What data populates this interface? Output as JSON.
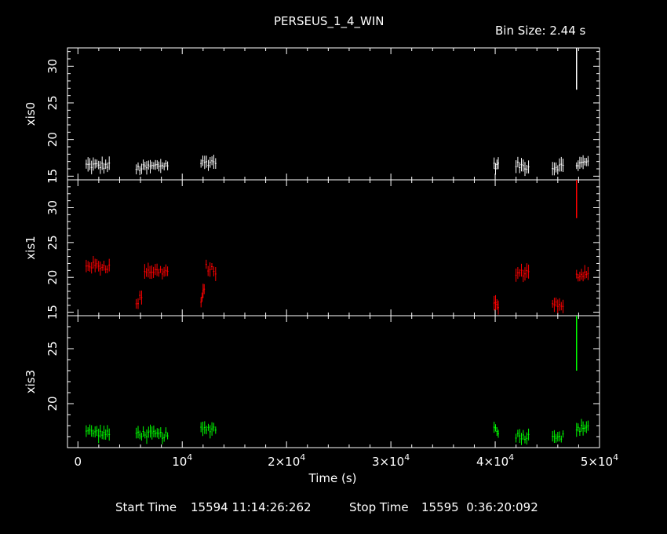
{
  "title": "PERSEUS_1_4_WIN",
  "bin_size": "Bin Size: 2.44 s",
  "start_time_label": "Start Time",
  "start_time_value": "15594 11:14:26:262",
  "stop_time_label": "Stop Time",
  "stop_time_value": "15595  0:36:20:092",
  "colors": {
    "background": "#000000",
    "axes": "#ffffff",
    "xis0": "#ffffff",
    "xis1": "#ff0000",
    "xis3": "#00ff00"
  },
  "chart_data": {
    "type": "scatter",
    "xlabel": "Time (s)",
    "xlim": [
      -1000,
      50000
    ],
    "x_ticks": [
      {
        "value": 0,
        "mantissa": "0",
        "exp": ""
      },
      {
        "value": 10000,
        "mantissa": "10",
        "exp": "4"
      },
      {
        "value": 20000,
        "mantissa": "2×10",
        "exp": "4"
      },
      {
        "value": 30000,
        "mantissa": "3×10",
        "exp": "4"
      },
      {
        "value": 40000,
        "mantissa": "4×10",
        "exp": "4"
      },
      {
        "value": 50000,
        "mantissa": "5×10",
        "exp": "4"
      }
    ],
    "panels": [
      {
        "name": "xis0",
        "color": "#ffffff",
        "ylim": [
          14.5,
          32.5
        ],
        "yticks": [
          15,
          20,
          25,
          30
        ],
        "segments": [
          {
            "x": [
              800,
              3000
            ],
            "y": [
              16.5,
              16.4
            ]
          },
          {
            "x": [
              5600,
              8600
            ],
            "y": [
              16.0,
              16.6
            ]
          },
          {
            "x": [
              11800,
              13200
            ],
            "y": [
              16.8,
              17.0
            ]
          },
          {
            "x": [
              39900,
              40300
            ],
            "y": [
              16.4,
              16.5
            ]
          },
          {
            "x": [
              42000,
              43200
            ],
            "y": [
              16.5,
              16.3
            ]
          },
          {
            "x": [
              45500,
              46500
            ],
            "y": [
              16.2,
              16.4
            ]
          },
          {
            "x": [
              47800,
              48900
            ],
            "y": [
              16.6,
              16.9
            ]
          }
        ],
        "spike": {
          "x": 47800,
          "y": [
            26.8,
            33
          ]
        }
      },
      {
        "name": "xis1",
        "color": "#ff0000",
        "ylim": [
          14.5,
          34
        ],
        "yticks": [
          15,
          20,
          25,
          30
        ],
        "segments": [
          {
            "x": [
              800,
              3000
            ],
            "y": [
              21.8,
              21.5
            ]
          },
          {
            "x": [
              5600,
              6100
            ],
            "y": [
              16.0,
              17.5
            ]
          },
          {
            "x": [
              6400,
              8600
            ],
            "y": [
              21.0,
              20.8
            ]
          },
          {
            "x": [
              11800,
              12100
            ],
            "y": [
              16.5,
              18.2
            ]
          },
          {
            "x": [
              12300,
              13200
            ],
            "y": [
              21.5,
              20.8
            ]
          },
          {
            "x": [
              39900,
              40300
            ],
            "y": [
              16.5,
              15.5
            ]
          },
          {
            "x": [
              42000,
              43200
            ],
            "y": [
              20.5,
              20.8
            ]
          },
          {
            "x": [
              45500,
              46500
            ],
            "y": [
              16.5,
              15.5
            ]
          },
          {
            "x": [
              47800,
              48900
            ],
            "y": [
              20.2,
              20.8
            ]
          }
        ],
        "spike": {
          "x": 47800,
          "y": [
            28.5,
            34
          ]
        }
      },
      {
        "name": "xis3",
        "color": "#00ff00",
        "ylim": [
          16,
          28
        ],
        "yticks": [
          20,
          25
        ],
        "segments": [
          {
            "x": [
              800,
              3000
            ],
            "y": [
              17.5,
              17.2
            ]
          },
          {
            "x": [
              5600,
              8600
            ],
            "y": [
              17.3,
              17.1
            ]
          },
          {
            "x": [
              11800,
              13200
            ],
            "y": [
              17.6,
              17.8
            ]
          },
          {
            "x": [
              39900,
              40300
            ],
            "y": [
              17.8,
              17.5
            ]
          },
          {
            "x": [
              42000,
              43200
            ],
            "y": [
              17.1,
              17.0
            ]
          },
          {
            "x": [
              45500,
              46500
            ],
            "y": [
              17.2,
              17.0
            ]
          },
          {
            "x": [
              47800,
              48900
            ],
            "y": [
              17.6,
              18.0
            ]
          }
        ],
        "spike": {
          "x": 47800,
          "y": [
            23,
            28
          ]
        }
      }
    ]
  }
}
